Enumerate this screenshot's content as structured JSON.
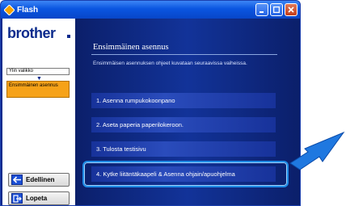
{
  "window": {
    "title": "Flash"
  },
  "sidebar": {
    "logo": "brother",
    "nav_top": "Ylin valikko",
    "nav_current": "Ensimmäinen asennus",
    "prev_button": "Edellinen",
    "quit_button": "Lopeta"
  },
  "main": {
    "heading": "Ensimmäinen asennus",
    "subtitle": "Ensimmäisen asennuksen ohjeet kuvataan seuraavissa vaiheissa.",
    "steps": [
      "1. Asenna rumpukokoonpano",
      "2. Aseta paperia paperilokeroon.",
      "3. Tulosta testisivu",
      "4. Kytke liitäntäkaapeli & Asenna ohjain/apuohjelma"
    ]
  },
  "colors": {
    "titlebar": "#0a55e0",
    "main_bg": "#123399",
    "nav_current_bg": "#f6a218",
    "highlight": "#1e8be6"
  }
}
